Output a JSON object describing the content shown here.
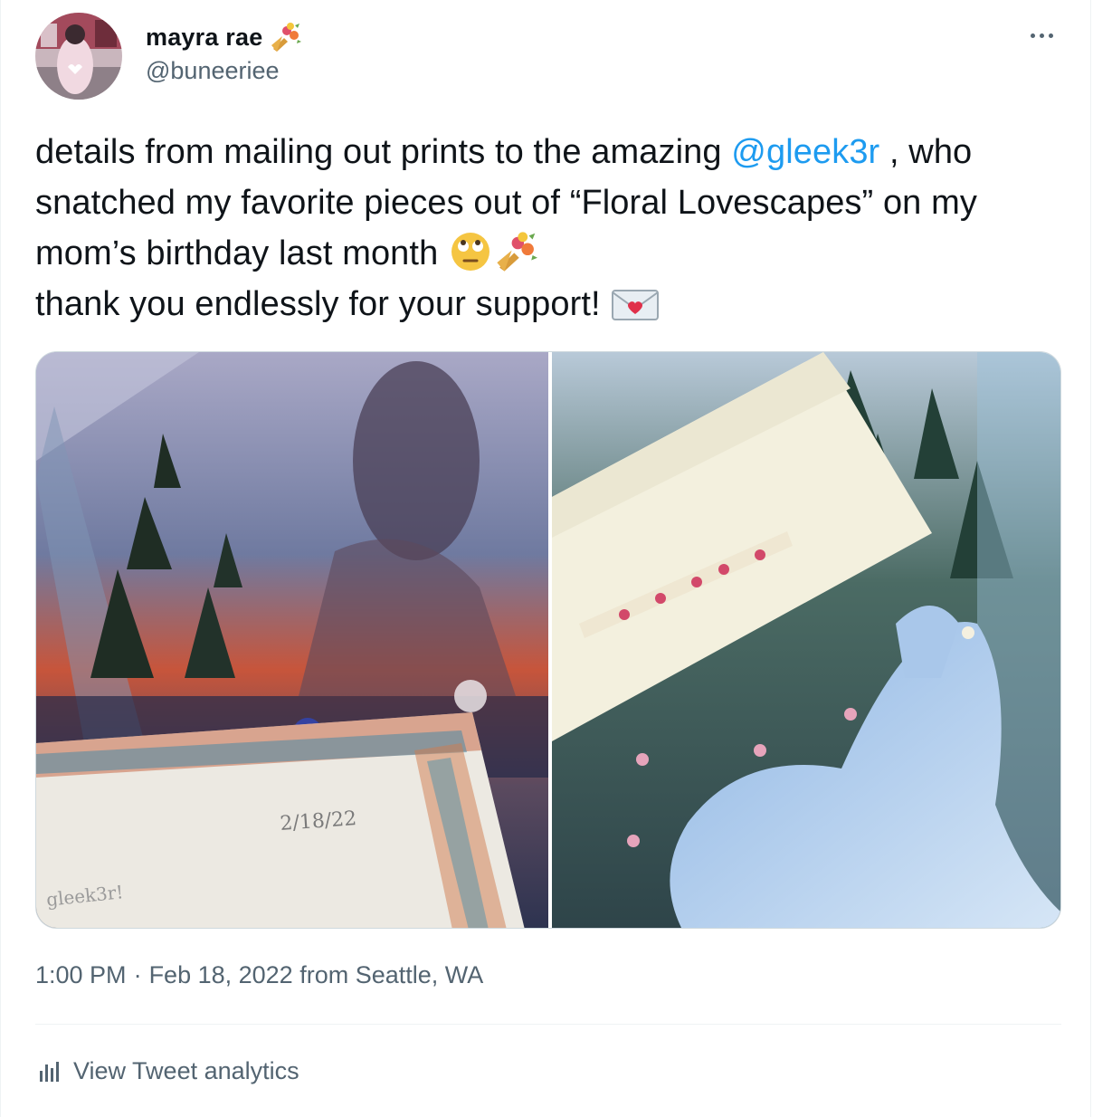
{
  "author": {
    "display_name": "mayra rae",
    "handle": "@buneeriee",
    "name_emoji": "bouquet-icon"
  },
  "tweet": {
    "text_part1": "details from mailing out prints to the amazing ",
    "mention": "@gleek3r",
    "text_part2": " , who snatched my favorite pieces out of “Floral Lovescapes” on my mom’s birthday last month ",
    "text_part3": "thank you endlessly for your support!  ",
    "emojis": [
      "face-with-rolling-eyes-icon",
      "bouquet-icon",
      "love-letter-icon"
    ]
  },
  "media": {
    "left": {
      "handwriting_date": "2/18/22",
      "handwriting_name": "gleek3r!"
    }
  },
  "meta": {
    "time": "1:00 PM",
    "separator": "·",
    "date": "Feb 18, 2022",
    "location": "from Seattle, WA"
  },
  "actions": {
    "analytics_label": "View Tweet analytics"
  },
  "colors": {
    "accent": "#1d9bf0",
    "secondary_text": "#536471",
    "border": "#eff3f4"
  }
}
